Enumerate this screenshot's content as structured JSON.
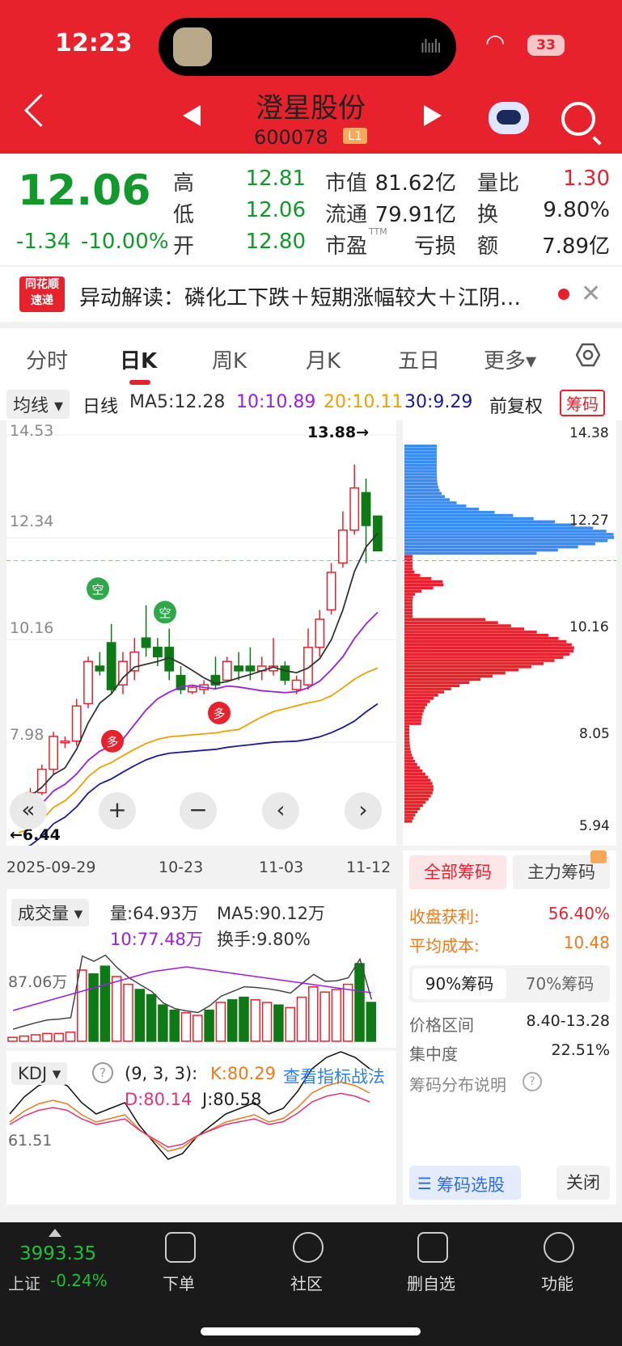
{
  "status_bar": {
    "time": "12:23",
    "battery": "33",
    "island_waves": "ılıılı"
  },
  "header": {
    "stock_name": "澄星股份",
    "stock_code": "600078",
    "level_badge": "L1"
  },
  "quote": {
    "price": "12.06",
    "change": "-1.34",
    "change_pct": "-10.00%",
    "high_label": "高",
    "high": "12.81",
    "low_label": "低",
    "low": "12.06",
    "open_label": "开",
    "open": "12.80",
    "mcap_label": "市值",
    "mcap": "81.62亿",
    "float_label": "流通",
    "float": "79.91亿",
    "pe_label": "市盈",
    "pe_sup": "TTM",
    "pe": "亏损",
    "vr_label": "量比",
    "vr": "1.30",
    "turn_label": "换",
    "turn": "9.80%",
    "amt_label": "额",
    "amt": "7.89亿"
  },
  "news": {
    "icon_text": "同花顺 速递",
    "text": "异动解读：磷化工下跌＋短期涨幅较大＋江阴…"
  },
  "tabs": [
    "分时",
    "日K",
    "周K",
    "月K",
    "五日",
    "更多▾"
  ],
  "ma_row": {
    "type": "均线 ▾",
    "period": "日线",
    "ma5": "MA5:12.28",
    "ma10": "10:10.89",
    "ma20": "20:10.11",
    "ma30": "30:9.29",
    "adjust": "前复权",
    "chip": "筹码"
  },
  "kchart": {
    "y_labels": [
      "14.53",
      "12.34",
      "10.16",
      "7.98"
    ],
    "high_mark": "13.88→",
    "low_mark": "←6.44",
    "x_labels": [
      "2025-09-29",
      "10-23",
      "11-03",
      "11-12"
    ],
    "colors": {
      "up": "#e8222d",
      "down": "#0e7a16",
      "ma5": "#333333",
      "ma10": "#9b1fe0",
      "ma20": "#f0a000",
      "ma30": "#1a1a9a"
    }
  },
  "chip_chart": {
    "y_labels": [
      "14.38",
      "12.27",
      "10.16",
      "8.05",
      "5.94"
    ],
    "colors": {
      "profit": "#e8222d",
      "loss": "#3b8cf0"
    }
  },
  "volume": {
    "selector": "成交量 ▾",
    "vol": "量:64.93万",
    "ma5": "MA5:90.12万",
    "ma10": "10:77.48万",
    "turnover": "换手:9.80%",
    "y_label": "87.06万"
  },
  "kdj": {
    "selector": "KDJ ▾",
    "params": "(9, 3, 3):",
    "k": "K:80.29",
    "link": "查看指标战法",
    "d": "D:80.14",
    "j": "J:80.58",
    "y_label": "61.51"
  },
  "chip_info": {
    "tab_all": "全部筹码",
    "tab_main": "主力筹码",
    "profit_label": "收盘获利:",
    "profit": "56.40%",
    "avg_label": "平均成本:",
    "avg": "10.48",
    "pct90": "90%筹码",
    "pct70": "70%筹码",
    "range_label": "价格区间",
    "range": "8.40-13.28",
    "conc_label": "集中度",
    "conc": "22.51%",
    "desc": "筹码分布说明",
    "select_btn": "筹码选股",
    "close_btn": "关闭"
  },
  "bottom_bar": {
    "index_value": "3993.35",
    "index_name": "上证",
    "index_chg": "-0.24%",
    "items": [
      "下单",
      "社区",
      "删自选",
      "功能"
    ]
  }
}
